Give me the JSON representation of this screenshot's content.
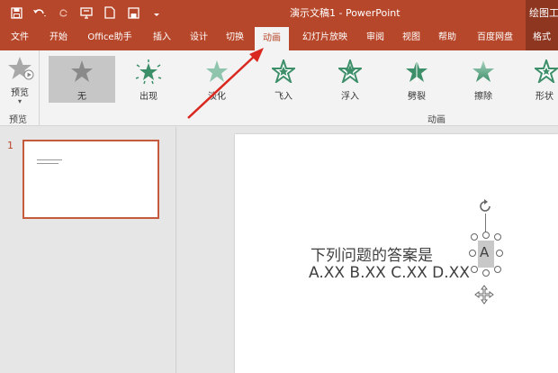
{
  "window": {
    "title": "演示文稿1  -  PowerPoint",
    "context_tab_title": "绘图工"
  },
  "qat": {
    "icons": [
      "save-icon",
      "undo-icon",
      "redo-icon",
      "present-icon",
      "new-icon",
      "save-as-icon",
      "more-icon"
    ]
  },
  "tabs": [
    {
      "label": "文件"
    },
    {
      "label": "开始"
    },
    {
      "label": "Office助手"
    },
    {
      "label": "插入"
    },
    {
      "label": "设计"
    },
    {
      "label": "切换"
    },
    {
      "label": "动画"
    },
    {
      "label": "幻灯片放映"
    },
    {
      "label": "审阅"
    },
    {
      "label": "视图"
    },
    {
      "label": "帮助"
    },
    {
      "label": "百度网盘"
    },
    {
      "label": "格式"
    }
  ],
  "active_tab": "动画",
  "ribbon": {
    "preview": {
      "label": "预览",
      "group_label": "预览"
    },
    "animations": [
      {
        "label": "无",
        "selected": true
      },
      {
        "label": "出现"
      },
      {
        "label": "淡化"
      },
      {
        "label": "飞入"
      },
      {
        "label": "浮入"
      },
      {
        "label": "劈裂"
      },
      {
        "label": "擦除"
      },
      {
        "label": "形状"
      }
    ],
    "group_label": "动画"
  },
  "slide_pane": {
    "slide_number": "1"
  },
  "slide": {
    "question": "下列问题的答案是",
    "options": "A.XX B.XX C.XX D.XX",
    "selected_text": "A"
  },
  "colors": {
    "accent": "#b7472a",
    "star_green": "#4a9e7a"
  }
}
